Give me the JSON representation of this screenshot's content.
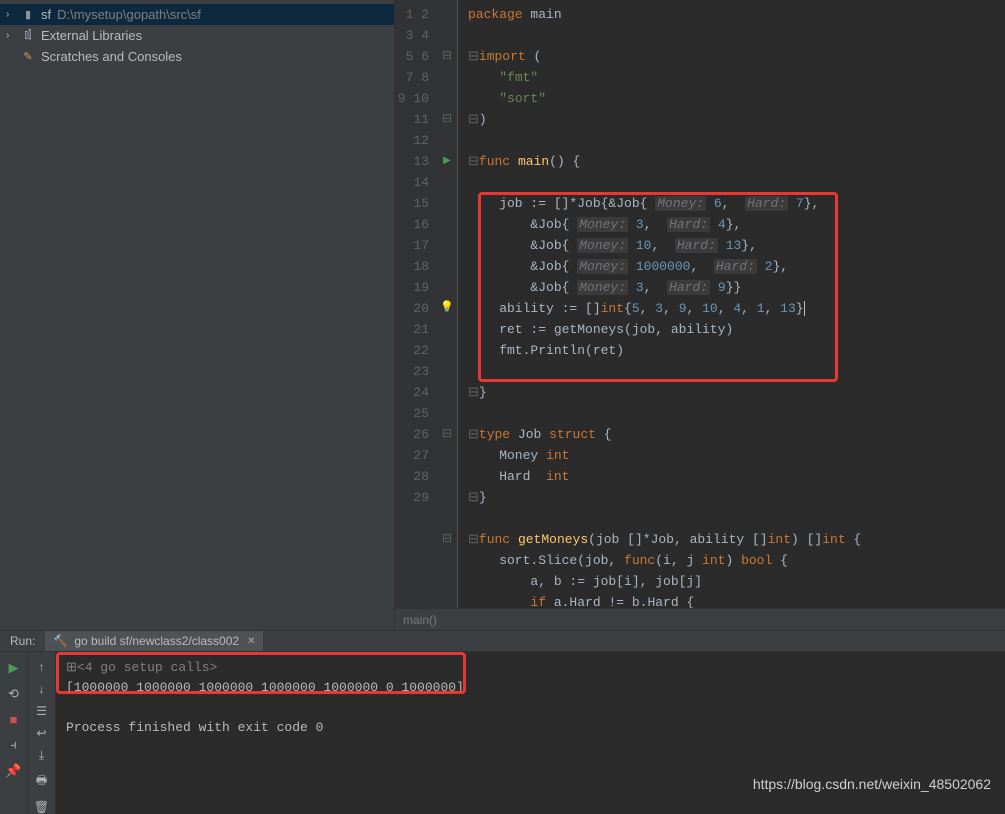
{
  "project": {
    "root_name": "sf",
    "root_path": "D:\\mysetup\\gopath\\src\\sf",
    "external_libraries": "External Libraries",
    "scratches": "Scratches and Consoles"
  },
  "code": {
    "lines": [
      "package main",
      "",
      "import (",
      "    \"fmt\"",
      "    \"sort\"",
      ")",
      "",
      "func main() {",
      "",
      "    job := []*Job{&Job{ Money: 6,  Hard: 7},",
      "        &Job{ Money: 3,  Hard: 4},",
      "        &Job{ Money: 10,  Hard: 13},",
      "        &Job{ Money: 1000000,  Hard: 2},",
      "        &Job{ Money: 3,  Hard: 9}}",
      "    ability := []int{5, 3, 9, 10, 4, 1, 13}",
      "    ret := getMoneys(job, ability)",
      "    fmt.Println(ret)",
      "",
      "}",
      "",
      "type Job struct {",
      "    Money int",
      "    Hard  int",
      "}",
      "",
      "func getMoneys(job []*Job, ability []int) []int {",
      "    sort.Slice(job, func(i, j int) bool {",
      "        a, b := job[i], job[j]",
      "        if a.Hard != b.Hard {"
    ],
    "line_numbers": [
      "1",
      "2",
      "3",
      "4",
      "5",
      "6",
      "7",
      "8",
      "9",
      "10",
      "11",
      "12",
      "13",
      "14",
      "15",
      "16",
      "17",
      "18",
      "19",
      "20",
      "21",
      "22",
      "23",
      "24",
      "25",
      "26",
      "27",
      "28",
      "29"
    ],
    "breadcrumb": "main()"
  },
  "run": {
    "label": "Run:",
    "tab": "go build sf/newclass2/class002",
    "setup_calls": "<4 go setup calls>",
    "output": "[1000000 1000000 1000000 1000000 1000000 0 1000000]",
    "exit": "Process finished with exit code 0"
  },
  "watermark": "https://blog.csdn.net/weixin_48502062"
}
